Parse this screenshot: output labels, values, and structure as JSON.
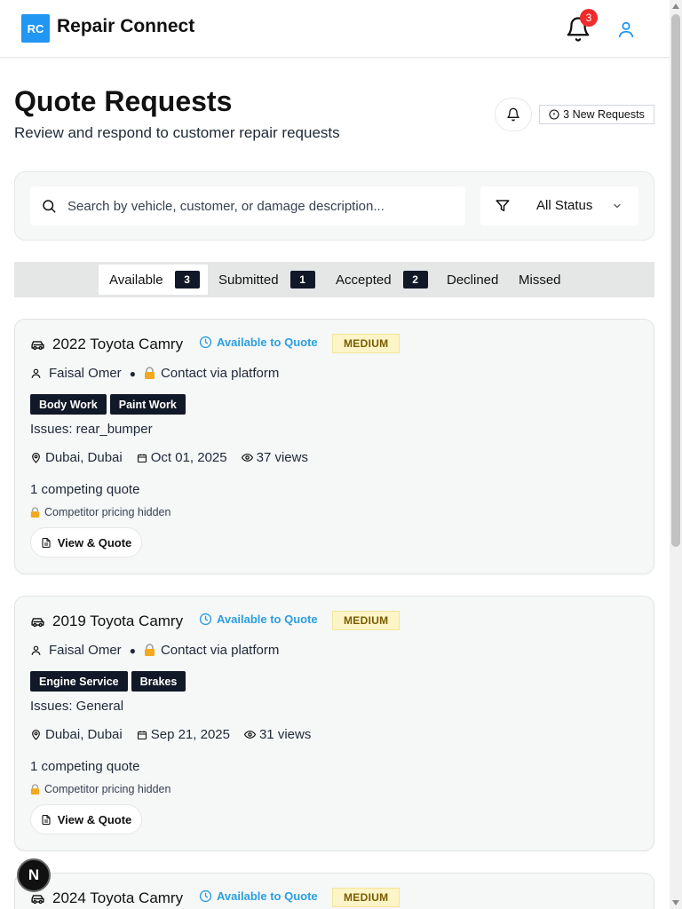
{
  "header": {
    "logo_text": "RC",
    "brand": "Repair Connect",
    "notification_count": "3",
    "accent": "#2196f3"
  },
  "page": {
    "title": "Quote Requests",
    "subtitle": "Review and respond to customer repair requests",
    "new_requests": "3 New Requests"
  },
  "filters": {
    "search_placeholder": "Search by vehicle, customer, or damage description...",
    "status_value": "All Status"
  },
  "tabs": [
    {
      "label": "Available",
      "count": "3"
    },
    {
      "label": "Submitted",
      "count": "1"
    },
    {
      "label": "Accepted",
      "count": "2"
    },
    {
      "label": "Declined"
    },
    {
      "label": "Missed"
    }
  ],
  "cards": [
    {
      "vehicle": "2022 Toyota Camry",
      "availability": "Available to Quote",
      "priority": "MEDIUM",
      "customer": "Faisal Omer",
      "contact": "Contact via platform",
      "tags": [
        "Body Work",
        "Paint Work"
      ],
      "issues": "Issues: rear_bumper",
      "location": "Dubai, Dubai",
      "date": "Oct 01, 2025",
      "views": "37 views",
      "competing": "1 competing quote",
      "pricing_note": "Competitor pricing hidden",
      "action": "View & Quote"
    },
    {
      "vehicle": "2019 Toyota Camry",
      "availability": "Available to Quote",
      "priority": "MEDIUM",
      "customer": "Faisal Omer",
      "contact": "Contact via platform",
      "tags": [
        "Engine Service",
        "Brakes"
      ],
      "issues": "Issues: General",
      "location": "Dubai, Dubai",
      "date": "Sep 21, 2025",
      "views": "31 views",
      "competing": "1 competing quote",
      "pricing_note": "Competitor pricing hidden",
      "action": "View & Quote"
    },
    {
      "vehicle": "2024 Toyota Camry",
      "availability": "Available to Quote",
      "priority": "MEDIUM"
    }
  ],
  "floating_badge": "N"
}
